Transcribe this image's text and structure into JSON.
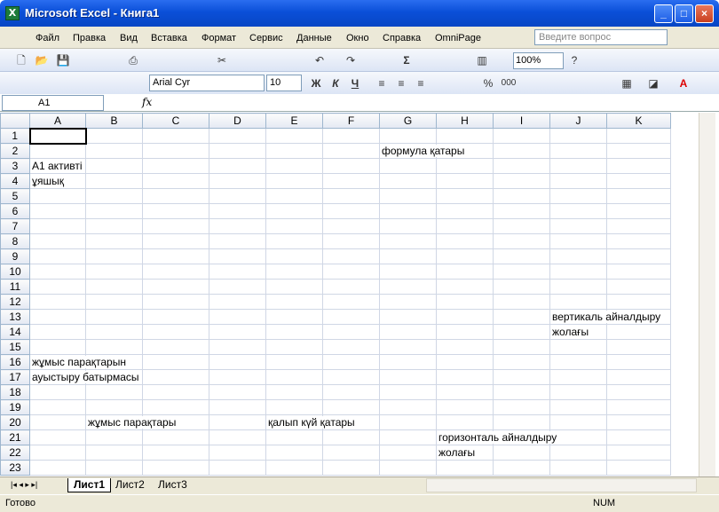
{
  "window": {
    "title": "Microsoft Excel - Книга1",
    "app_icon": "excel-icon",
    "buttons": [
      "_",
      "□",
      "×"
    ]
  },
  "menu": {
    "items": [
      "Файл",
      "Правка",
      "Вид",
      "Вставка",
      "Формат",
      "Сервис",
      "Данные",
      "Окно",
      "Справка",
      "OmniPage"
    ],
    "help_placeholder": "Введите вопрос"
  },
  "toolbar": {
    "zoom": "100%",
    "font_name": "Arial Cyr",
    "font_size": "10",
    "bold": "Ж",
    "italic": "К",
    "underline": "Ч",
    "percent": "%",
    "thousands": "000"
  },
  "formula_bar": {
    "name_box": "A1",
    "fx_label": "fx",
    "content": ""
  },
  "grid": {
    "columns": [
      "A",
      "B",
      "C",
      "D",
      "E",
      "F",
      "G",
      "H",
      "I",
      "J",
      "K"
    ],
    "rows": [
      "1",
      "2",
      "3",
      "4",
      "5",
      "6",
      "7",
      "8",
      "9",
      "10",
      "11",
      "12",
      "13",
      "14",
      "15",
      "16",
      "17",
      "18",
      "19",
      "20",
      "21",
      "22",
      "23"
    ],
    "cells": {
      "G2": "формула қатары",
      "A3": "А1 активті",
      "A4": "ұяшық",
      "J13": "вертикаль айналдыру",
      "J14": "жолағы",
      "A16": "жұмыс парақтарын",
      "A17": "ауыстыру батырмасы",
      "B20": "жұмыс парақтары",
      "E20": "қалып күй қатары",
      "H21": "горизонталь айналдыру",
      "H22": "жолағы"
    }
  },
  "sheets": {
    "tabs": [
      "Лист1",
      "Лист2",
      "Лист3"
    ],
    "active": "Лист1"
  },
  "status": {
    "text": "Готово",
    "num": "NUM"
  }
}
